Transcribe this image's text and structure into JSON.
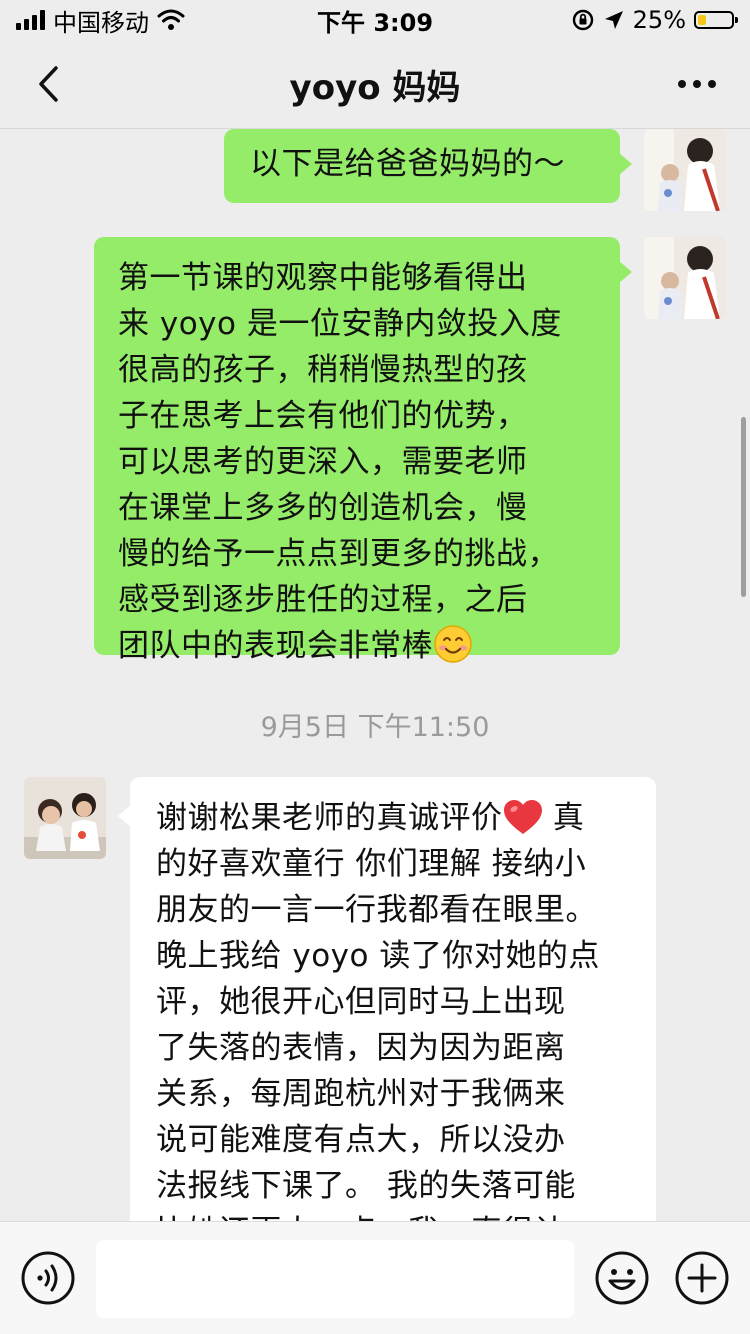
{
  "status_bar": {
    "carrier": "中国移动",
    "time": "下午 3:09",
    "battery_text": "25%",
    "battery_level": 0.25,
    "battery_color": "#f5c518"
  },
  "nav": {
    "title": "yoyo 妈妈",
    "back_icon": "chevron-left-icon",
    "more_icon": "more-dots-icon"
  },
  "messages": [
    {
      "sender": "me",
      "lines": [
        "以下是给爸爸妈妈的～"
      ]
    },
    {
      "sender": "me",
      "lines": [
        "第一节课的观察中能够看得出",
        "来 yoyo 是一位安静内敛投入度",
        "很高的孩子，稍稍慢热型的孩",
        "子在思考上会有他们的优势，",
        "可以思考的更深入，需要老师",
        "在课堂上多多的创造机会，慢",
        "慢的给予一点点到更多的挑战，",
        "感受到逐步胜任的过程，之后",
        "团队中的表现会非常棒"
      ],
      "trailing_emoji": "smiling-face-icon"
    },
    {
      "sender": "other",
      "lines": [
        "谢谢松果老师的真诚评价",
        "的好喜欢童行  你们理解 接纳小",
        "朋友的一言一行我都看在眼里。",
        "晚上我给 yoyo 读了你对她的点",
        "评，她很开心但同时马上出现",
        "了失落的表情，因为因为距离",
        "关系，每周跑杭州对于我俩来",
        "说可能难度有点大，所以没办",
        "法报线下课了。 我的失落可能",
        "比她还更大一点，我一直很认"
      ],
      "inline_emoji_after_first": "red-heart-icon",
      "first_line_suffix": " 真"
    }
  ],
  "timestamp": "9月5日 下午11:50",
  "input_bar": {
    "voice_icon": "voice-icon",
    "emoji_icon": "emoji-icon",
    "plus_icon": "plus-icon",
    "input_value": ""
  },
  "colors": {
    "my_bubble": "#95ec69",
    "other_bubble": "#ffffff",
    "background": "#ededed"
  }
}
